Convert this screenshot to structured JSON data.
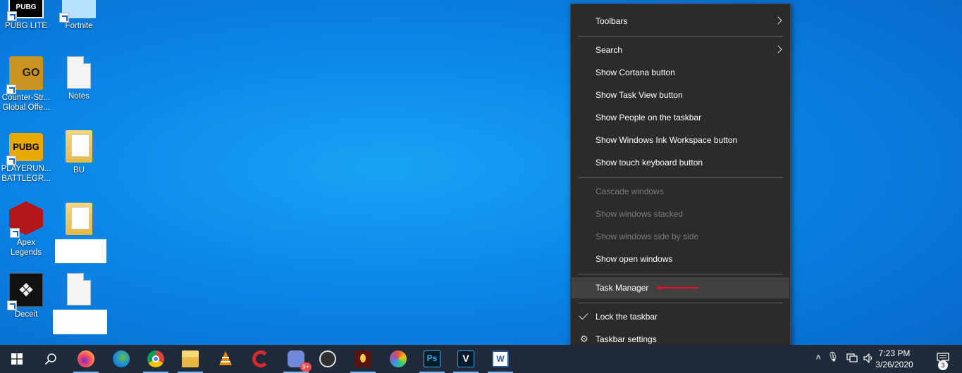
{
  "desktop": {
    "icons": [
      {
        "label": "PUBG LITE"
      },
      {
        "label": "Fortnite"
      },
      {
        "label": "Counter-Str...\nGlobal Offe...",
        "l1": "Counter-Str...",
        "l2": "Global Offe..."
      },
      {
        "label": "Notes"
      },
      {
        "label": "PLAYERUN... BATTLEGR...",
        "l1": "PLAYERUN...",
        "l2": "BATTLEGR..."
      },
      {
        "label": "BU"
      },
      {
        "label": "Apex Legends",
        "l1": "Apex",
        "l2": "Legends"
      },
      {
        "label": "Deceit"
      }
    ],
    "pubg_logo_text": "PUBG",
    "go_logo_text": "GO"
  },
  "context_menu": {
    "toolbars": "Toolbars",
    "search": "Search",
    "show_cortana": "Show Cortana button",
    "show_task_view": "Show Task View button",
    "show_people": "Show People on the taskbar",
    "show_ink": "Show Windows Ink Workspace button",
    "show_touch_keyboard": "Show touch keyboard button",
    "cascade": "Cascade windows",
    "stacked": "Show windows stacked",
    "side_by_side": "Show windows side by side",
    "show_open": "Show open windows",
    "task_manager": "Task Manager",
    "lock_taskbar": "Lock the taskbar",
    "taskbar_settings": "Taskbar settings"
  },
  "taskbar": {
    "apps": [
      "start-icon",
      "search-icon",
      "firefox-icon",
      "edge-icon",
      "chrome-icon",
      "file-explorer-icon",
      "vlc-icon",
      "ccleaner-icon",
      "discord-icon",
      "obs-icon",
      "app-icon",
      "paint-icon",
      "photoshop-icon",
      "vegas-icon",
      "word-icon"
    ],
    "discord_badge": "9+",
    "ps_text": "Ps",
    "v_text": "V",
    "w_text": "W",
    "time": "7:23 PM",
    "date": "3/26/2020",
    "notification_count": "3"
  },
  "colors": {
    "accent_red": "#e81123",
    "menu_bg": "#2b2b2b",
    "taskbar_bg": "#1f2b3a"
  }
}
